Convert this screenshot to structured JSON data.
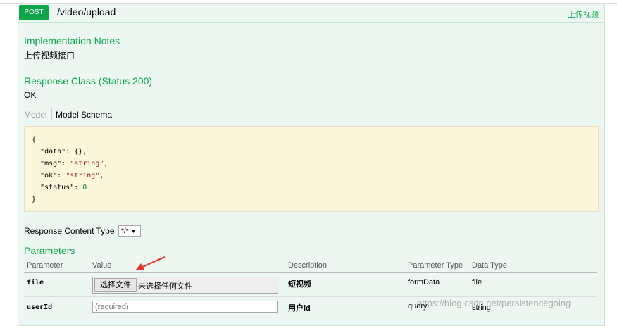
{
  "operation": {
    "method": "POST",
    "path": "/video/upload",
    "summary": "上传视频"
  },
  "implementation_notes": {
    "title": "Implementation Notes",
    "text": "上传视频接口"
  },
  "response_class": {
    "title": "Response Class (Status 200)",
    "text": "OK"
  },
  "schema_tabs": {
    "model": "Model",
    "model_schema": "Model Schema"
  },
  "schema": {
    "open": "{",
    "data_key": "\"data\"",
    "data_val": "{},",
    "msg_key": "\"msg\"",
    "msg_val": "\"string\"",
    "ok_key": "\"ok\"",
    "ok_val": "\"string\"",
    "status_key": "\"status\"",
    "status_val": "0",
    "close": "}"
  },
  "response_content_type": {
    "label": "Response Content Type",
    "selected": "*/*"
  },
  "parameters": {
    "title": "Parameters",
    "columns": [
      "Parameter",
      "Value",
      "Description",
      "Parameter Type",
      "Data Type"
    ],
    "rows": [
      {
        "name": "file",
        "button": "选择文件",
        "file_status": "未选择任何文件",
        "description": "短视频",
        "param_type": "formData",
        "data_type": "file"
      },
      {
        "name": "userId",
        "placeholder": "(required)",
        "description": "用户id",
        "param_type": "query",
        "data_type": "string"
      }
    ]
  },
  "watermark": "https://blog.csdn.net/persistencegoing",
  "colors": {
    "accent": "#10a54a",
    "panel_bg": "#ebf7f0",
    "schema_bg": "#fcf6db",
    "arrow": "#e8342c"
  }
}
